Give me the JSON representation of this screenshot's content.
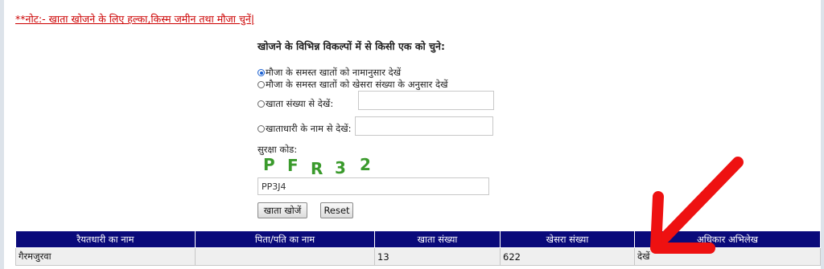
{
  "note": {
    "stars": "**",
    "text": "नोट:- खाता खोजने के लिए हल्का,किस्म जमीन तथा मौजा चुनें|"
  },
  "heading": "खोजने के विभिन्न विकल्पों में से किसी एक को चुने:",
  "options": [
    {
      "label": "मौजा के समस्त खातों को नामानुसार देखें",
      "checked": true
    },
    {
      "label": "मौजा के समस्त खातों को खेसरा संख्या के अनुसार देखें",
      "checked": false
    },
    {
      "label": "खाता संख्या से देखें:",
      "checked": false
    },
    {
      "label": "खाताधारी के नाम से देखें:",
      "checked": false
    }
  ],
  "captcha": {
    "label": "सुरक्षा कोड:",
    "chars": [
      "P",
      "F",
      "R",
      "3",
      "2"
    ],
    "color": "#3a9a2c"
  },
  "captcha_input_value": "PP3J4",
  "buttons": {
    "search": "खाता खोजें",
    "reset": "Reset"
  },
  "table": {
    "headers": [
      "रैयतधारी का नाम",
      "पिता/पति का नाम",
      "खाता संख्या",
      "खेसरा संख्या",
      "अधिकार अभिलेख"
    ],
    "rows": [
      [
        "गैरमजुरवा",
        "",
        "13",
        "622",
        "देखें"
      ]
    ],
    "header_color": "#0a0a7a"
  },
  "annotation": {
    "type": "arrow",
    "color": "#ee1111",
    "points_to": "देखें"
  }
}
